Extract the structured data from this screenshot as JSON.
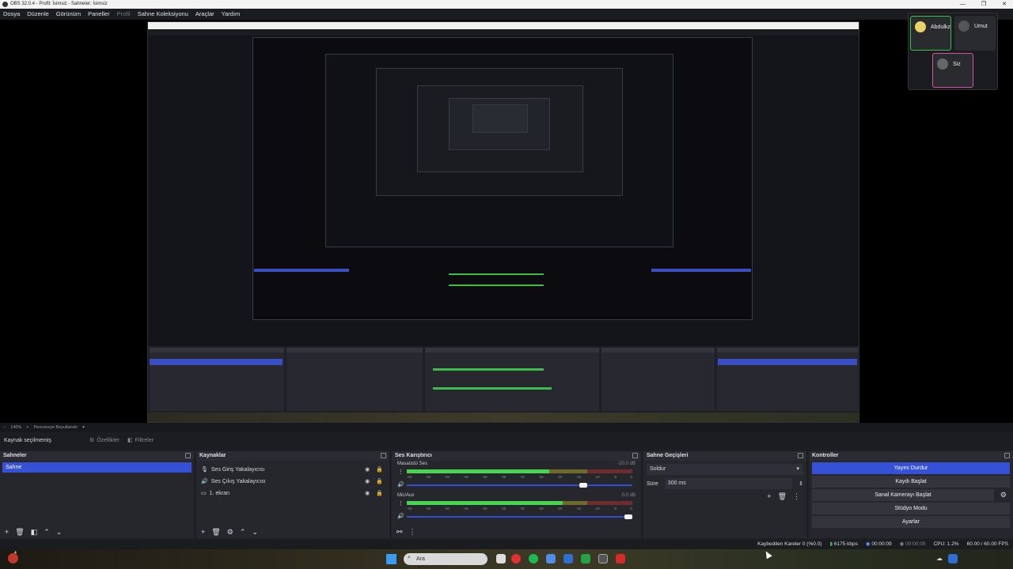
{
  "window": {
    "title": "OBS 32.0.4 - Profil: İsimsiz - Sahneler: İsimsiz",
    "controls": [
      "—",
      "❐",
      "✕"
    ]
  },
  "menu": [
    "Dosya",
    "Düzenle",
    "Görünüm",
    "Paneller",
    "Profil",
    "Sahne Koleksiyonu",
    "Araçlar",
    "Yardım"
  ],
  "video_call": {
    "participants": [
      {
        "name": "Abdulkz",
        "border": "#3cbf48"
      },
      {
        "name": "Umut",
        "border": "#333333"
      },
      {
        "name": "Siz",
        "border": "#d84fb0"
      }
    ]
  },
  "zoom": {
    "percent": "140%",
    "mode": "Pencereye Boyutlandır"
  },
  "source_bar": {
    "label": "Kaynak seçilmemiş",
    "properties": "Özellikler",
    "filters": "Filtreler"
  },
  "docks": {
    "scenes": {
      "title": "Sahneler",
      "items": [
        "Sahne"
      ]
    },
    "sources": {
      "title": "Kaynaklar",
      "items": [
        {
          "label": "Ses Giriş Yakalayıcısı",
          "icon": "microphone-icon"
        },
        {
          "label": "Ses Çıkış Yakalayıcısı",
          "icon": "speaker-icon"
        },
        {
          "label": "1. ekran",
          "icon": "monitor-icon"
        }
      ]
    },
    "mixer": {
      "title": "Ses Karıştırıcı",
      "channels": [
        {
          "name": "Masaüstü Ses",
          "db": "-20.0 dB",
          "level": 0.63,
          "volume": 0.8
        },
        {
          "name": "Mic/Aux",
          "db": "0.0 dB",
          "level": 0.69,
          "volume": 1.0
        }
      ],
      "scale": [
        "-60",
        "-55",
        "-50",
        "-45",
        "-40",
        "-35",
        "-30",
        "-25",
        "-20",
        "-15",
        "-10",
        "-5",
        "0"
      ]
    },
    "transitions": {
      "title": "Sahne Geçişleri",
      "selected": "Soldur",
      "duration_label": "Süre",
      "duration": "300 ms"
    },
    "controls": {
      "title": "Kontroller",
      "buttons": [
        "Yayını Durdur",
        "Kaydı Başlat",
        "Sanal Kamerayı Başlat",
        "Stüdyo Modu",
        "Ayarlar"
      ]
    }
  },
  "status": {
    "dropped": "Kaybedilen Kareler 0 (%0.0)",
    "bitrate": "6175 kbps",
    "stream_time": "00:00:09",
    "rec_time": "00:00:00",
    "cpu": "CPU: 1.2%",
    "fps": "60.00 / 60.00 FPS"
  },
  "taskbar": {
    "search_placeholder": "Ara",
    "badge": "4"
  },
  "colors": {
    "accent": "#3650d6",
    "meter_green": "#47d54f",
    "panel": "#26272d"
  }
}
